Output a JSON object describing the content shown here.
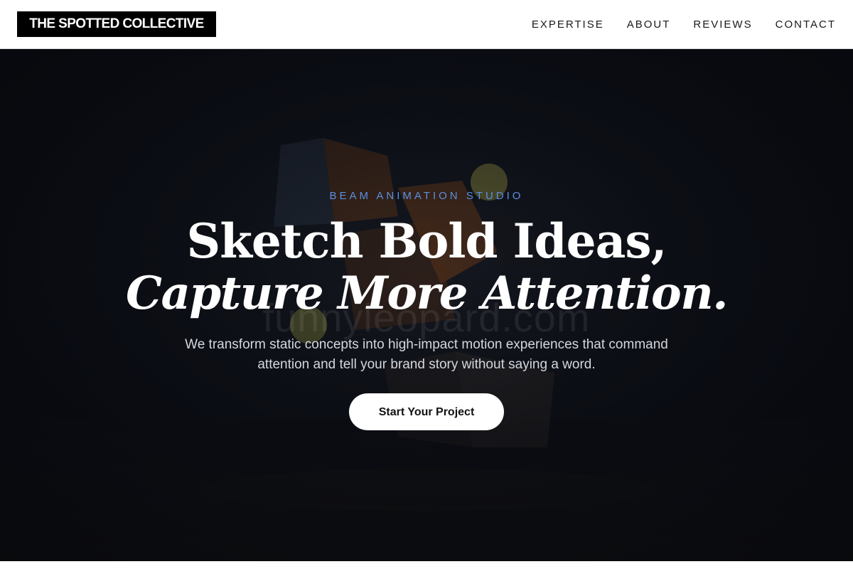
{
  "header": {
    "logo_text": "THE SPOTTED COLLECTIVE",
    "nav": [
      {
        "label": "EXPERTISE"
      },
      {
        "label": "ABOUT"
      },
      {
        "label": "REVIEWS"
      },
      {
        "label": "CONTACT"
      }
    ]
  },
  "hero": {
    "eyebrow": "BEAM ANIMATION STUDIO",
    "headline_line1": "Sketch Bold Ideas,",
    "headline_line2": "Capture More Attention.",
    "subtext": "We transform static concepts into high-impact motion experiences that command attention and tell your brand story without saying a word.",
    "cta_label": "Start Your Project",
    "watermark": "funnyleopard.com"
  },
  "colors": {
    "header_bg": "#ffffff",
    "logo_bg": "#000000",
    "eyebrow": "#5b8fe0",
    "hero_bg": "#0c0e14",
    "cta_bg": "#ffffff"
  }
}
